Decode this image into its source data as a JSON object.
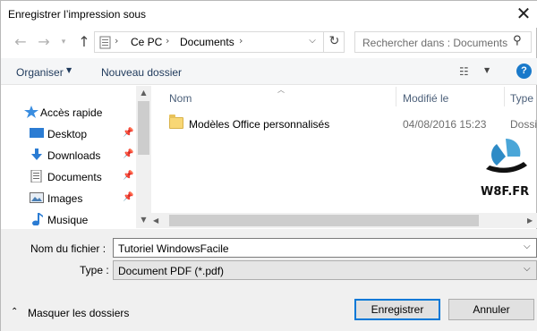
{
  "window": {
    "title": "Enregistrer l’impression sous"
  },
  "nav": {
    "breadcrumb": [
      "Ce PC",
      "Documents"
    ],
    "search_placeholder": "Rechercher dans : Documents"
  },
  "toolbar": {
    "organize": "Organiser",
    "new_folder": "Nouveau dossier"
  },
  "sidebar": {
    "items": [
      {
        "label": "Accès rapide",
        "icon": "star-icon",
        "pinned": false
      },
      {
        "label": "Desktop",
        "icon": "desktop-icon",
        "pinned": true
      },
      {
        "label": "Downloads",
        "icon": "download-icon",
        "pinned": true
      },
      {
        "label": "Documents",
        "icon": "document-icon",
        "pinned": true
      },
      {
        "label": "Images",
        "icon": "images-icon",
        "pinned": true
      },
      {
        "label": "Musique",
        "icon": "music-icon",
        "pinned": false
      }
    ]
  },
  "filelist": {
    "columns": [
      "Nom",
      "Modifié le",
      "Type"
    ],
    "rows": [
      {
        "name": "Modèles Office personnalisés",
        "modified": "04/08/2016 15:23",
        "type": "Dossie"
      }
    ]
  },
  "watermark": {
    "text": "W8F.FR"
  },
  "form": {
    "filename_label": "Nom du fichier :",
    "filename_value": "Tutoriel WindowsFacile",
    "type_label": "Type :",
    "type_value": "Document PDF (*.pdf)"
  },
  "footer": {
    "hide_folders": "Masquer les dossiers",
    "save": "Enregistrer",
    "cancel": "Annuler"
  },
  "colors": {
    "accent": "#0078d7",
    "help": "#1979ca",
    "folder": "#f8d775"
  }
}
